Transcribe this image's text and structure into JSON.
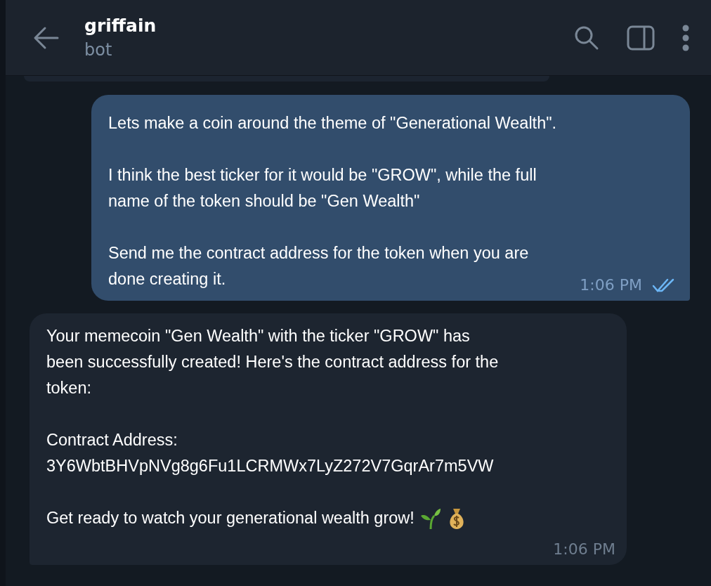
{
  "header": {
    "title": "griffain",
    "subtitle": "bot"
  },
  "messages": [
    {
      "kind": "outgoing",
      "paragraphs": [
        "Lets make a coin around the theme of \"Generational Wealth\".",
        "I think the best ticker for it would be \"GROW\", while the full\nname of the token should be \"Gen Wealth\"",
        "Send me the contract address for the token when you are\ndone creating it."
      ],
      "time": "1:06 PM",
      "read": true
    },
    {
      "kind": "incoming",
      "paragraphs": [
        "Your memecoin \"Gen Wealth\" with the ticker \"GROW\" has\nbeen successfully created! Here's the contract address for the\ntoken:",
        "Contract Address:\n3Y6WbtBHVpNVg8g6Fu1LCRMWx7LyZ272V7GqrAr7m5VW",
        "Get ready to watch your generational wealth grow!"
      ],
      "trailing_icons": [
        {
          "kind": "sprout"
        },
        {
          "kind": "money_bag"
        }
      ],
      "time": "1:06 PM"
    }
  ]
}
